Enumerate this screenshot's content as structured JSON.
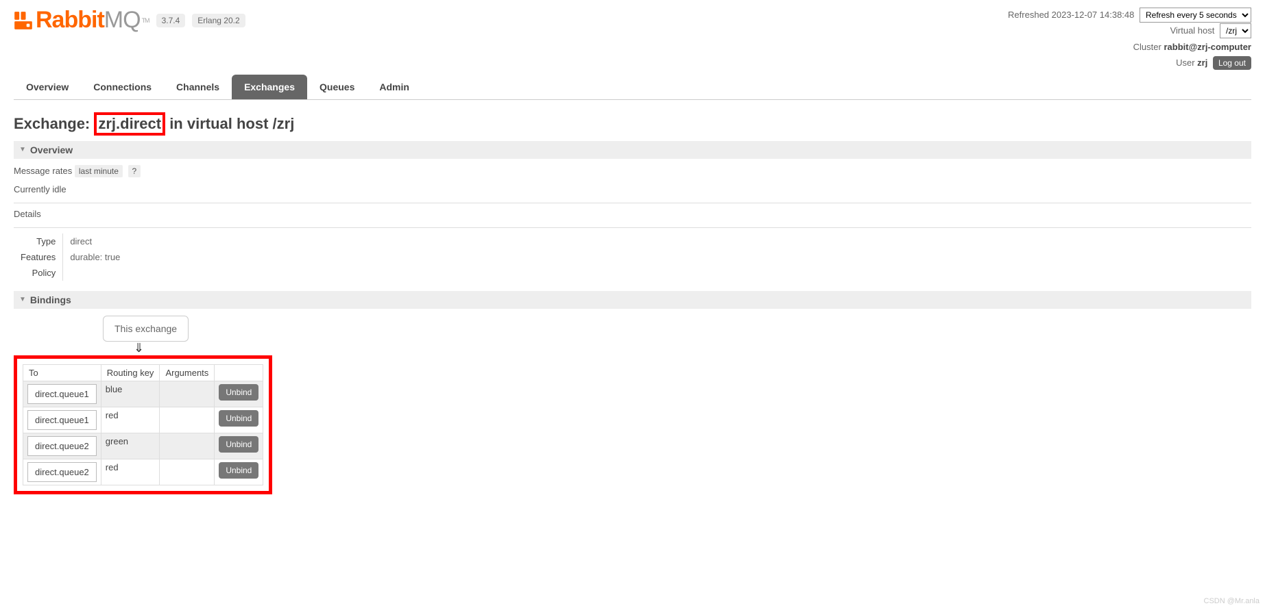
{
  "header": {
    "logo_rabbit": "Rabbit",
    "logo_mq": "MQ",
    "tm": "TM",
    "version": "3.7.4",
    "erlang": "Erlang 20.2",
    "refreshed_label": "Refreshed",
    "refreshed_time": "2023-12-07 14:38:48",
    "refresh_option": "Refresh every 5 seconds",
    "vhost_label": "Virtual host",
    "vhost_value": "/zrj",
    "cluster_label": "Cluster",
    "cluster_value": "rabbit@zrj-computer",
    "user_label": "User",
    "user_value": "zrj",
    "logout": "Log out"
  },
  "tabs": {
    "overview": "Overview",
    "connections": "Connections",
    "channels": "Channels",
    "exchanges": "Exchanges",
    "queues": "Queues",
    "admin": "Admin",
    "active": "exchanges"
  },
  "page": {
    "title_prefix": "Exchange: ",
    "exchange_name": "zrj.direct",
    "title_mid": " in virtual host ",
    "vhost": "/zrj"
  },
  "overview": {
    "section_title": "Overview",
    "msg_rates_label": "Message rates",
    "msg_rates_period": "last minute",
    "help": "?",
    "idle_text": "Currently idle",
    "details_label": "Details",
    "type_label": "Type",
    "type_value": "direct",
    "features_label": "Features",
    "features_value": "durable: true",
    "policy_label": "Policy",
    "policy_value": ""
  },
  "bindings": {
    "section_title": "Bindings",
    "this_exchange": "This exchange",
    "col_to": "To",
    "col_routing": "Routing key",
    "col_args": "Arguments",
    "unbind": "Unbind",
    "rows": [
      {
        "to": "direct.queue1",
        "routing": "blue",
        "args": ""
      },
      {
        "to": "direct.queue1",
        "routing": "red",
        "args": ""
      },
      {
        "to": "direct.queue2",
        "routing": "green",
        "args": ""
      },
      {
        "to": "direct.queue2",
        "routing": "red",
        "args": ""
      }
    ]
  },
  "watermark": "CSDN @Mr.anla"
}
